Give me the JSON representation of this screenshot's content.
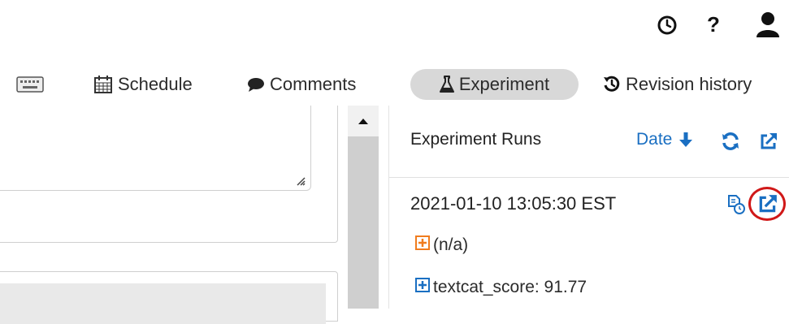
{
  "topbar": {
    "icons": [
      "clock-icon",
      "question-icon",
      "user-icon"
    ]
  },
  "tabs": [
    {
      "label": "",
      "icon": "keyboard-icon"
    },
    {
      "label": "Schedule",
      "icon": "calendar-icon"
    },
    {
      "label": "Comments",
      "icon": "comments-icon"
    },
    {
      "label": "Experiment",
      "icon": "flask-icon",
      "active": true
    },
    {
      "label": "Revision history",
      "icon": "history-icon"
    }
  ],
  "experiment": {
    "title": "Experiment Runs",
    "sort_label": "Date",
    "runs": [
      {
        "timestamp": "2021-01-10 13:05:30 EST",
        "items": [
          {
            "label": "(n/a)",
            "color": "#f07c1e"
          },
          {
            "label": "textcat_score: 91.77",
            "color": "#1a6fc2"
          }
        ]
      }
    ]
  },
  "colors": {
    "accent": "#1a6fc2",
    "highlight_circle": "#d01818",
    "active_tab_bg": "#d8d8d8"
  }
}
